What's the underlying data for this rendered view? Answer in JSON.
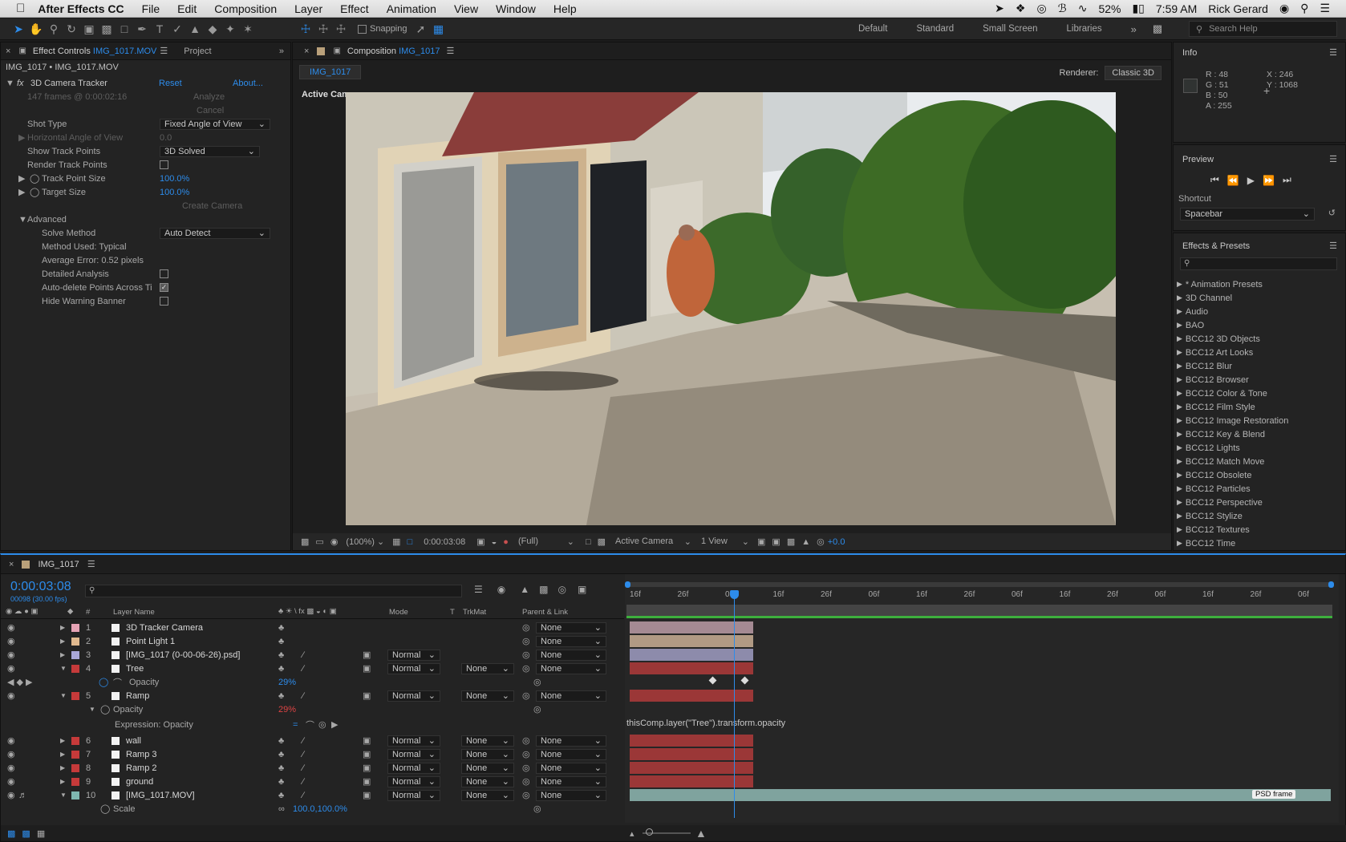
{
  "menubar": {
    "app_name": "After Effects CC",
    "items": [
      "File",
      "Edit",
      "Composition",
      "Layer",
      "Effect",
      "Animation",
      "View",
      "Window",
      "Help"
    ],
    "battery": "52%",
    "time": "7:59 AM",
    "user": "Rick Gerard"
  },
  "toolbar": {
    "snapping_label": "Snapping",
    "workspaces": [
      "Default",
      "Standard",
      "Small Screen",
      "Libraries"
    ],
    "search_placeholder": "Search Help"
  },
  "effect_controls": {
    "tab_label": "Effect Controls",
    "tab_file": "IMG_1017.MOV",
    "project_tab": "Project",
    "breadcrumb": "IMG_1017 • IMG_1017.MOV",
    "effect_name": "3D Camera Tracker",
    "reset": "Reset",
    "about": "About...",
    "frames_info": "147 frames @ 0:00:02:16",
    "analyze": "Analyze",
    "cancel": "Cancel",
    "shot_type_label": "Shot Type",
    "shot_type_value": "Fixed Angle of View",
    "hav_label": "Horizontal Angle of View",
    "hav_value": "0.0",
    "show_tp_label": "Show Track Points",
    "show_tp_value": "3D Solved",
    "render_tp_label": "Render Track Points",
    "tp_size_label": "Track Point Size",
    "tp_size_value": "100.0%",
    "target_size_label": "Target Size",
    "target_size_value": "100.0%",
    "create_camera": "Create Camera",
    "advanced_label": "Advanced",
    "solve_method_label": "Solve Method",
    "solve_method_value": "Auto Detect",
    "method_used": "Method Used: Typical",
    "avg_error": "Average Error: 0.52 pixels",
    "detailed_label": "Detailed Analysis",
    "autodelete_label": "Auto-delete Points Across Ti",
    "hide_warning_label": "Hide Warning Banner"
  },
  "composition": {
    "tab_label": "Composition",
    "tab_name": "IMG_1017",
    "subtab": "IMG_1017",
    "renderer_label": "Renderer:",
    "renderer_value": "Classic 3D",
    "view_label": "Active Camera",
    "zoom": "(100%)",
    "timecode": "0:00:03:08",
    "resolution": "(Full)",
    "camera": "Active Camera",
    "views": "1 View",
    "exposure": "+0.0"
  },
  "info": {
    "title": "Info",
    "r": "R : 48",
    "g": "G : 51",
    "b": "B : 50",
    "a": "A : 255",
    "x": "X : 246",
    "y": "Y : 1068"
  },
  "preview": {
    "title": "Preview",
    "shortcut_label": "Shortcut",
    "shortcut_value": "Spacebar"
  },
  "effects_presets": {
    "title": "Effects & Presets",
    "items": [
      "* Animation Presets",
      "3D Channel",
      "Audio",
      "BAO",
      "BCC12 3D Objects",
      "BCC12 Art Looks",
      "BCC12 Blur",
      "BCC12 Browser",
      "BCC12 Color & Tone",
      "BCC12 Film Style",
      "BCC12 Image Restoration",
      "BCC12 Key & Blend",
      "BCC12 Lights",
      "BCC12 Match Move",
      "BCC12 Obsolete",
      "BCC12 Particles",
      "BCC12 Perspective",
      "BCC12 Stylize",
      "BCC12 Textures",
      "BCC12 Time"
    ]
  },
  "timeline": {
    "comp_name": "IMG_1017",
    "timecode": "0:00:03:08",
    "frame_info": "00098 (30.00 fps)",
    "col_num": "#",
    "col_layer_name": "Layer Name",
    "col_mode": "Mode",
    "col_t": "T",
    "col_trkmat": "TrkMat",
    "col_parent": "Parent & Link",
    "ruler": [
      "16f",
      "26f",
      "06f",
      "16f",
      "26f",
      "06f",
      "16f",
      "26f",
      "06f",
      "16f",
      "26f",
      "06f",
      "16f",
      "26f",
      "06f"
    ],
    "layers": [
      {
        "num": "1",
        "name": "3D Tracker Camera",
        "mode": "",
        "trkmat": "",
        "parent": "None",
        "color": "#e6a3b5"
      },
      {
        "num": "2",
        "name": "Point Light 1",
        "mode": "",
        "trkmat": "",
        "parent": "None",
        "color": "#e0b98f"
      },
      {
        "num": "3",
        "name": "[IMG_1017 (0-00-06-26).psd]",
        "mode": "Normal",
        "trkmat": "",
        "parent": "None",
        "color": "#a9a7d8"
      },
      {
        "num": "4",
        "name": "Tree",
        "mode": "Normal",
        "trkmat": "None",
        "parent": "None",
        "color": "#c53a3a"
      },
      {
        "num": "5",
        "name": "Ramp",
        "mode": "Normal",
        "trkmat": "None",
        "parent": "None",
        "color": "#c53a3a"
      },
      {
        "num": "6",
        "name": "wall",
        "mode": "Normal",
        "trkmat": "None",
        "parent": "None",
        "color": "#c53a3a"
      },
      {
        "num": "7",
        "name": "Ramp 3",
        "mode": "Normal",
        "trkmat": "None",
        "parent": "None",
        "color": "#c53a3a"
      },
      {
        "num": "8",
        "name": "Ramp 2",
        "mode": "Normal",
        "trkmat": "None",
        "parent": "None",
        "color": "#c53a3a"
      },
      {
        "num": "9",
        "name": "ground",
        "mode": "Normal",
        "trkmat": "None",
        "parent": "None",
        "color": "#c53a3a"
      },
      {
        "num": "10",
        "name": "[IMG_1017.MOV]",
        "mode": "Normal",
        "trkmat": "None",
        "parent": "None",
        "color": "#7fb7b0"
      }
    ],
    "opacity_label": "Opacity",
    "tree_opacity": "29%",
    "ramp_opacity": "29%",
    "expression_label": "Expression: Opacity",
    "expression": "thisComp.layer(\"Tree\").transform.opacity",
    "scale_label": "Scale",
    "scale_value": "100.0,100.0%",
    "psd_marker": "PSD frame"
  }
}
